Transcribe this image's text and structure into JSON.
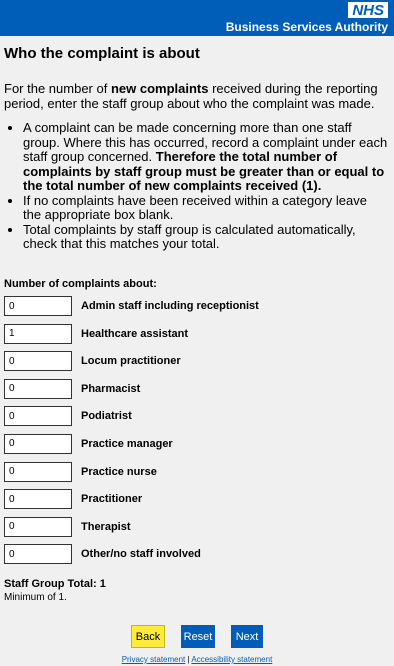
{
  "header": {
    "logo_text": "NHS",
    "org_name": "Business Services Authority",
    "brand_color": "#005eb8"
  },
  "page_title": "Who the complaint is about",
  "intro": {
    "before": "For the number of ",
    "bold": "new complaints",
    "after": " received during the reporting period, enter the staff group about who the complaint was made."
  },
  "notes": [
    {
      "text": "A complaint can be made concerning more than one staff group. Where this has occurred, record a complaint under each staff group concerned. ",
      "bold": "Therefore the total number of complaints by staff group must be greater than or equal to the total number of new complaints received (1)."
    },
    {
      "text": "If no complaints have been received within a category leave the appropriate box blank.",
      "bold": ""
    },
    {
      "text": "Total complaints by staff group is calculated automatically, check that this matches your total.",
      "bold": ""
    }
  ],
  "section_label": "Number of complaints about:",
  "staff_groups": [
    {
      "label": "Admin staff including receptionist",
      "value": "0"
    },
    {
      "label": "Healthcare assistant",
      "value": "1"
    },
    {
      "label": "Locum practitioner",
      "value": "0"
    },
    {
      "label": "Pharmacist",
      "value": "0"
    },
    {
      "label": "Podiatrist",
      "value": "0"
    },
    {
      "label": "Practice manager",
      "value": "0"
    },
    {
      "label": "Practice nurse",
      "value": "0"
    },
    {
      "label": "Practitioner",
      "value": "0"
    },
    {
      "label": "Therapist",
      "value": "0"
    },
    {
      "label": "Other/no staff involved",
      "value": "0"
    }
  ],
  "total": {
    "label": "Staff Group Total: 1",
    "minimum": "Minimum of 1."
  },
  "buttons": {
    "back": "Back",
    "reset": "Reset",
    "next": "Next"
  },
  "footer": {
    "privacy": "Privacy statement",
    "separator": " | ",
    "accessibility": "Accessibility statement"
  }
}
